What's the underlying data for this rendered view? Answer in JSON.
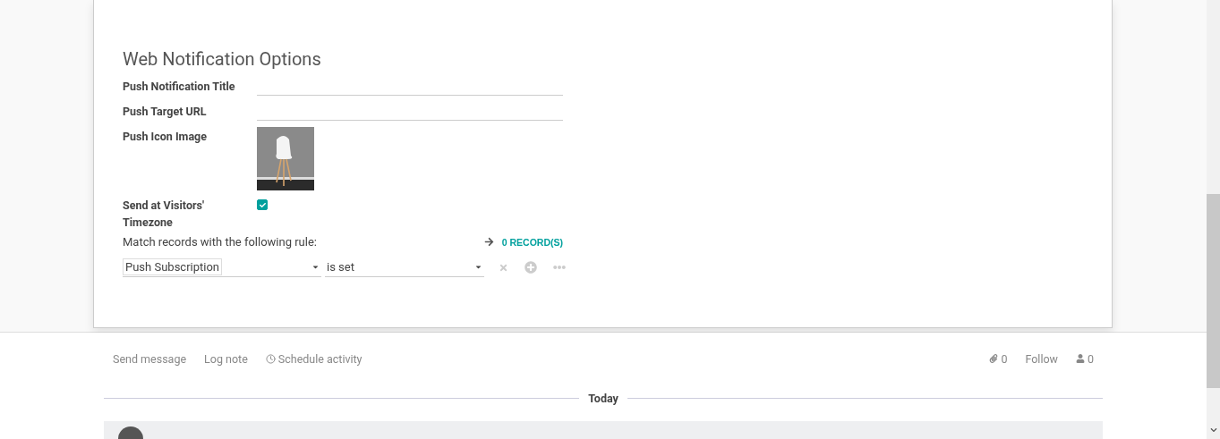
{
  "form": {
    "section_title": "Web Notification Options",
    "fields": [
      {
        "kind": "text",
        "label": "Push Notification Title"
      },
      {
        "kind": "text",
        "label": "Push Target URL"
      },
      {
        "label": "Push Icon Image"
      },
      {
        "kind": "checkbox",
        "label": "Send at Visitors' Timezone",
        "checked": true
      }
    ],
    "rule": {
      "label": "Match records with the following rule:",
      "records": "0 RECORD(S)",
      "field": "Push Subscription",
      "operator": "is set"
    }
  },
  "chatter": {
    "actions": [
      {
        "kind": "message",
        "label": "Send message"
      },
      {
        "kind": "note",
        "label": "Log note"
      },
      {
        "kind": "activity",
        "label": "Schedule activity"
      }
    ],
    "attachments": "0",
    "follow": "Follow",
    "followers": "0",
    "date_separator": "Today"
  }
}
